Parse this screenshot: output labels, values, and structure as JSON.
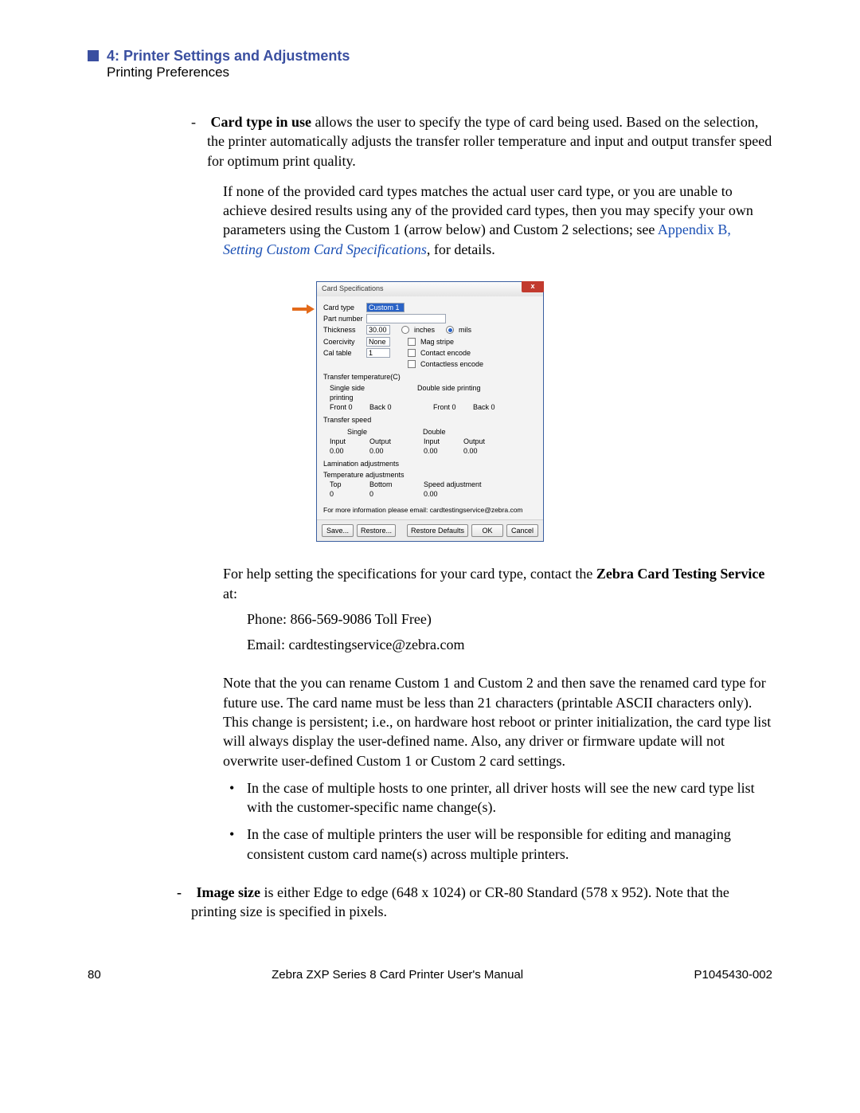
{
  "header": {
    "chapter": "4: Printer Settings and Adjustments",
    "section": "Printing Preferences"
  },
  "text": {
    "cardtype_lead_bold": "Card type in use",
    "cardtype_lead_rest": " allows the user to specify the type of card being used. Based on the selection, the printer automatically adjusts the transfer roller temperature and input and output transfer speed for optimum print quality.",
    "cardtype_p2_a": "If none of the provided card types matches the actual user card type, or you are unable to achieve desired results using any of the provided card types, then you may specify your own parameters using the Custom 1 (arrow below) and Custom 2 selections; see ",
    "cardtype_p2_link1": "Appendix B",
    "cardtype_p2_sep": ", ",
    "cardtype_p2_link2": "Setting Custom Card Specifications",
    "cardtype_p2_b": ", for details.",
    "help_a": "For help setting the specifications for your card type, contact the ",
    "help_bold": "Zebra Card Testing Service",
    "help_b": " at:",
    "phone": "Phone: 866-569-9086   Toll Free)",
    "email": "Email:  cardtestingservice@zebra.com",
    "note": "Note that the you can rename Custom 1 and Custom 2 and then save the renamed card type for future use. The card name must be less than 21 characters (printable ASCII characters only). This change is persistent; i.e., on hardware host reboot or printer initialization, the card type list will always display the user-defined name. Also, any driver or firmware update will not overwrite user-defined Custom 1 or Custom 2 card settings.",
    "sub1": "In the case of multiple hosts to one printer, all driver hosts will see the new card type list with the customer-specific name change(s).",
    "sub2": "In the case of multiple printers the user will be responsible for editing and managing consistent custom card name(s) across multiple printers.",
    "imgsize_bold": "Image size",
    "imgsize_rest": " is either Edge to edge (648 x 1024) or CR-80 Standard (578 x 952). Note that the printing size is specified in pixels."
  },
  "dialog": {
    "title": "Card Specifications",
    "labels": {
      "card_type": "Card type",
      "part_number": "Part number",
      "thickness": "Thickness",
      "coercivity": "Coercivity",
      "cal_table": "Cal table",
      "inches": "inches",
      "mils": "mils",
      "mag_stripe": "Mag stripe",
      "contact_encode": "Contact encode",
      "contactless_encode": "Contactless encode",
      "transfer_temp": "Transfer temperature(C)",
      "single_side": "Single side printing",
      "double_side": "Double side printing",
      "front": "Front",
      "back": "Back",
      "transfer_speed": "Transfer speed",
      "single": "Single",
      "double": "Double",
      "input": "Input",
      "output": "Output",
      "lamination": "Lamination adjustments",
      "temp_adj": "Temperature adjustments",
      "top": "Top",
      "bottom": "Bottom",
      "speed_adj": "Speed adjustment",
      "info": "For more information please email: cardtestingservice@zebra.com"
    },
    "values": {
      "card_type": "Custom 1",
      "thickness": "30.00",
      "coercivity": "None",
      "cal_table": "1",
      "zero": "0",
      "zero_dec": "0.00"
    },
    "buttons": {
      "save": "Save...",
      "restore": "Restore...",
      "restore_defaults": "Restore Defaults",
      "ok": "OK",
      "cancel": "Cancel"
    }
  },
  "footer": {
    "page": "80",
    "center": "Zebra ZXP Series 8 Card Printer User's Manual",
    "right": "P1045430-002"
  }
}
